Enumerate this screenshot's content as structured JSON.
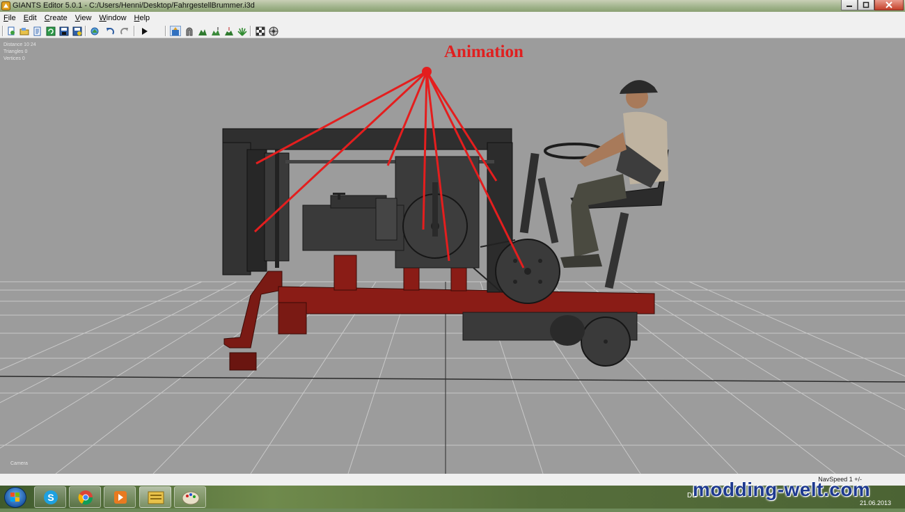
{
  "window": {
    "title": "GIANTS Editor 5.0.1 - C:/Users/Henni/Desktop/FahrgestellBrummer.i3d",
    "controls": [
      "minimize",
      "maximize",
      "close"
    ]
  },
  "menu": [
    {
      "mnemonic": "F",
      "rest": "ile"
    },
    {
      "mnemonic": "E",
      "rest": "dit"
    },
    {
      "mnemonic": "C",
      "rest": "reate"
    },
    {
      "mnemonic": "V",
      "rest": "iew"
    },
    {
      "mnemonic": "W",
      "rest": "indow"
    },
    {
      "mnemonic": "H",
      "rest": "elp"
    }
  ],
  "toolbar": {
    "icons": [
      "new-file-icon",
      "open-file-icon",
      "import-icon",
      "refresh-icon",
      "save-icon",
      "save-all-icon",
      "scene-icon",
      "undo-icon",
      "redo-icon",
      "play-icon",
      "select-icon",
      "magnet-icon",
      "terrain-raise-icon",
      "terrain-smooth-icon",
      "foliage-icon",
      "paint-icon",
      "paint-texture-icon",
      "paint-color-icon"
    ]
  },
  "viewport": {
    "hud_lines": [
      "Distance 10 24",
      "Triangles 0",
      "Vertices 0"
    ],
    "camera_label": "Camera",
    "annotation": "Animation",
    "annotation_color": "#e01f1f"
  },
  "statusbar": {
    "navspeed": "NavSpeed 1 +/-"
  },
  "taskbar": {
    "apps": [
      "skype-icon",
      "chrome-icon",
      "media-player-icon",
      "files-icon",
      "paint-icon"
    ],
    "tray_text": "DE",
    "clock_date": "21.06.2013"
  },
  "watermark": "modding-welt.com"
}
